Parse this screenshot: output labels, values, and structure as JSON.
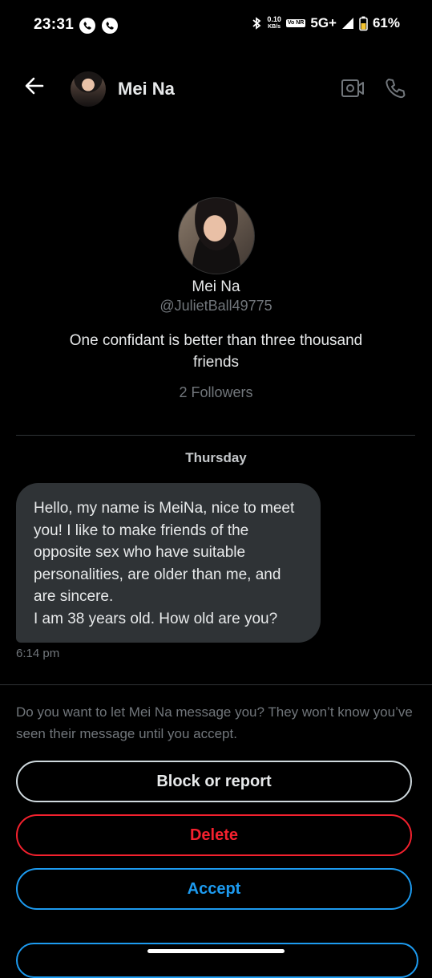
{
  "status_bar": {
    "time": "23:31",
    "speed_value": "0.10",
    "speed_unit": "KB/s",
    "volte": "Vo NR",
    "network": "5G+",
    "battery": "61%"
  },
  "header": {
    "name": "Mei Na",
    "icons": [
      "back-arrow-icon",
      "video-call-icon",
      "phone-icon"
    ]
  },
  "profile": {
    "name": "Mei Na",
    "handle": "@JulietBall49775",
    "bio": "One confidant is better than three thousand friends",
    "followers": "2 Followers"
  },
  "conversation": {
    "day_label": "Thursday",
    "message": "Hello, my name is MeiNa, nice to meet you! I like to make friends of the opposite sex who have suitable personalities, are older than me, and are sincere.\nI am 38 years old. How old are you?",
    "message_time": "6:14 pm"
  },
  "request": {
    "prompt": "Do you want to let Mei Na message you? They won’t know you’ve seen their message until you accept.",
    "block_label": "Block or report",
    "delete_label": "Delete",
    "accept_label": "Accept"
  },
  "colors": {
    "background": "#000000",
    "bubble": "#2f3336",
    "accent_blue": "#1d9bf0",
    "danger_red": "#f4212e",
    "muted_text": "#71767b"
  }
}
